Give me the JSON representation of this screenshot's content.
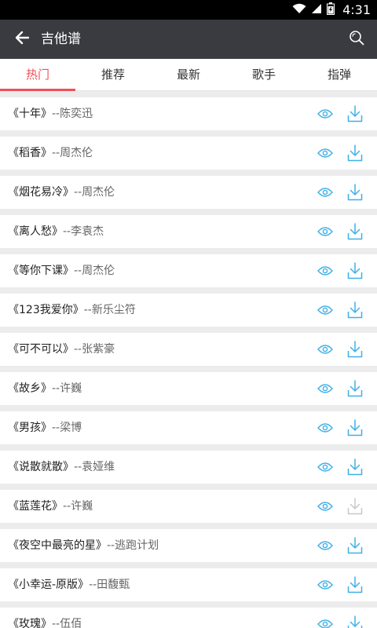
{
  "status_bar": {
    "time": "4:31"
  },
  "app_bar": {
    "title": "吉他谱"
  },
  "tabs": [
    {
      "label": "热门",
      "active": true
    },
    {
      "label": "推荐",
      "active": false
    },
    {
      "label": "最新",
      "active": false
    },
    {
      "label": "歌手",
      "active": false
    },
    {
      "label": "指弹",
      "active": false
    }
  ],
  "songs": [
    {
      "title": "《十年》",
      "artist": "--陈奕迅",
      "downloaded": false
    },
    {
      "title": "《稻香》",
      "artist": "--周杰伦",
      "downloaded": false
    },
    {
      "title": "《烟花易冷》",
      "artist": "--周杰伦",
      "downloaded": false
    },
    {
      "title": "《离人愁》",
      "artist": "--李袁杰",
      "downloaded": false
    },
    {
      "title": "《等你下课》",
      "artist": "--周杰伦",
      "downloaded": false
    },
    {
      "title": "《123我爱你》",
      "artist": "--新乐尘符",
      "downloaded": false
    },
    {
      "title": "《可不可以》",
      "artist": "--张紫豪",
      "downloaded": false
    },
    {
      "title": "《故乡》",
      "artist": "--许巍",
      "downloaded": false
    },
    {
      "title": "《男孩》",
      "artist": "--梁博",
      "downloaded": false
    },
    {
      "title": "《说散就散》",
      "artist": "--袁娅维",
      "downloaded": false
    },
    {
      "title": "《蓝莲花》",
      "artist": "--许巍",
      "downloaded": true
    },
    {
      "title": "《夜空中最亮的星》",
      "artist": "--逃跑计划",
      "downloaded": false
    },
    {
      "title": "《小幸运-原版》",
      "artist": "--田馥甄",
      "downloaded": false
    },
    {
      "title": "《玫瑰》",
      "artist": "--伍佰",
      "downloaded": false
    }
  ],
  "colors": {
    "accent": "#f0505a",
    "icon_blue": "#3fb0e8",
    "icon_disabled": "#c8c8c8",
    "app_bar": "#3a3b40"
  }
}
